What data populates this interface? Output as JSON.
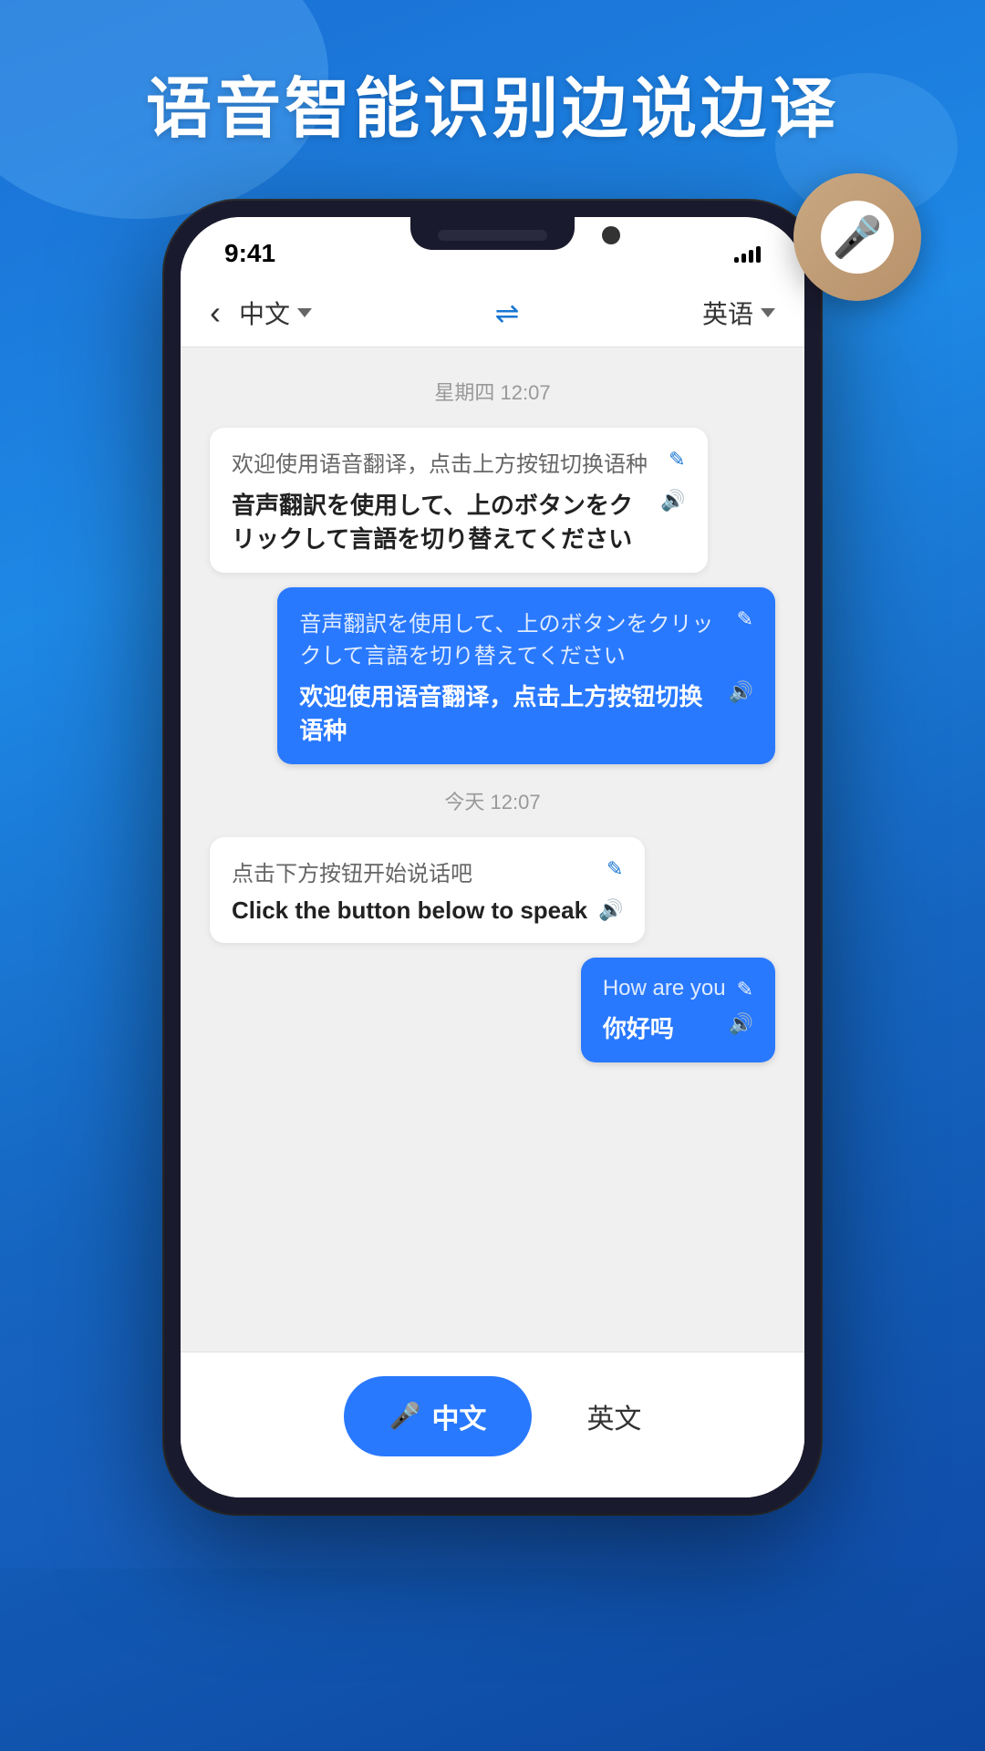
{
  "page": {
    "title": "语音智能识别边说边译",
    "background_color": "#1565c0"
  },
  "status_bar": {
    "time": "9:41",
    "signal_label": "signal"
  },
  "nav": {
    "back_label": "‹",
    "lang_left": "中文",
    "lang_right": "英语",
    "swap_icon": "⇌",
    "dropdown_arrow": "▾"
  },
  "chat": {
    "timestamp1": "星期四 12:07",
    "msg1_original": "欢迎使用语音翻译，点击上方按钮切换语种",
    "msg1_translated": "音声翻訳を使用して、上のボタンをクリックして言語を切り替えてください",
    "msg2_original": "音声翻訳を使用して、上のボタンをクリックして言語を切り替えてください",
    "msg2_translated": "欢迎使用语音翻译，点击上方按钮切换语种",
    "timestamp2": "今天 12:07",
    "msg3_original": "点击下方按钮开始说话吧",
    "msg3_translated": "Click the button below to speak",
    "msg4_original": "How are you",
    "msg4_translated": "你好吗"
  },
  "toolbar": {
    "chinese_btn": "中文",
    "english_btn": "英文",
    "mic_icon": "🎤"
  },
  "icons": {
    "edit": "✎",
    "sound": "🔊",
    "mic": "🎤"
  }
}
